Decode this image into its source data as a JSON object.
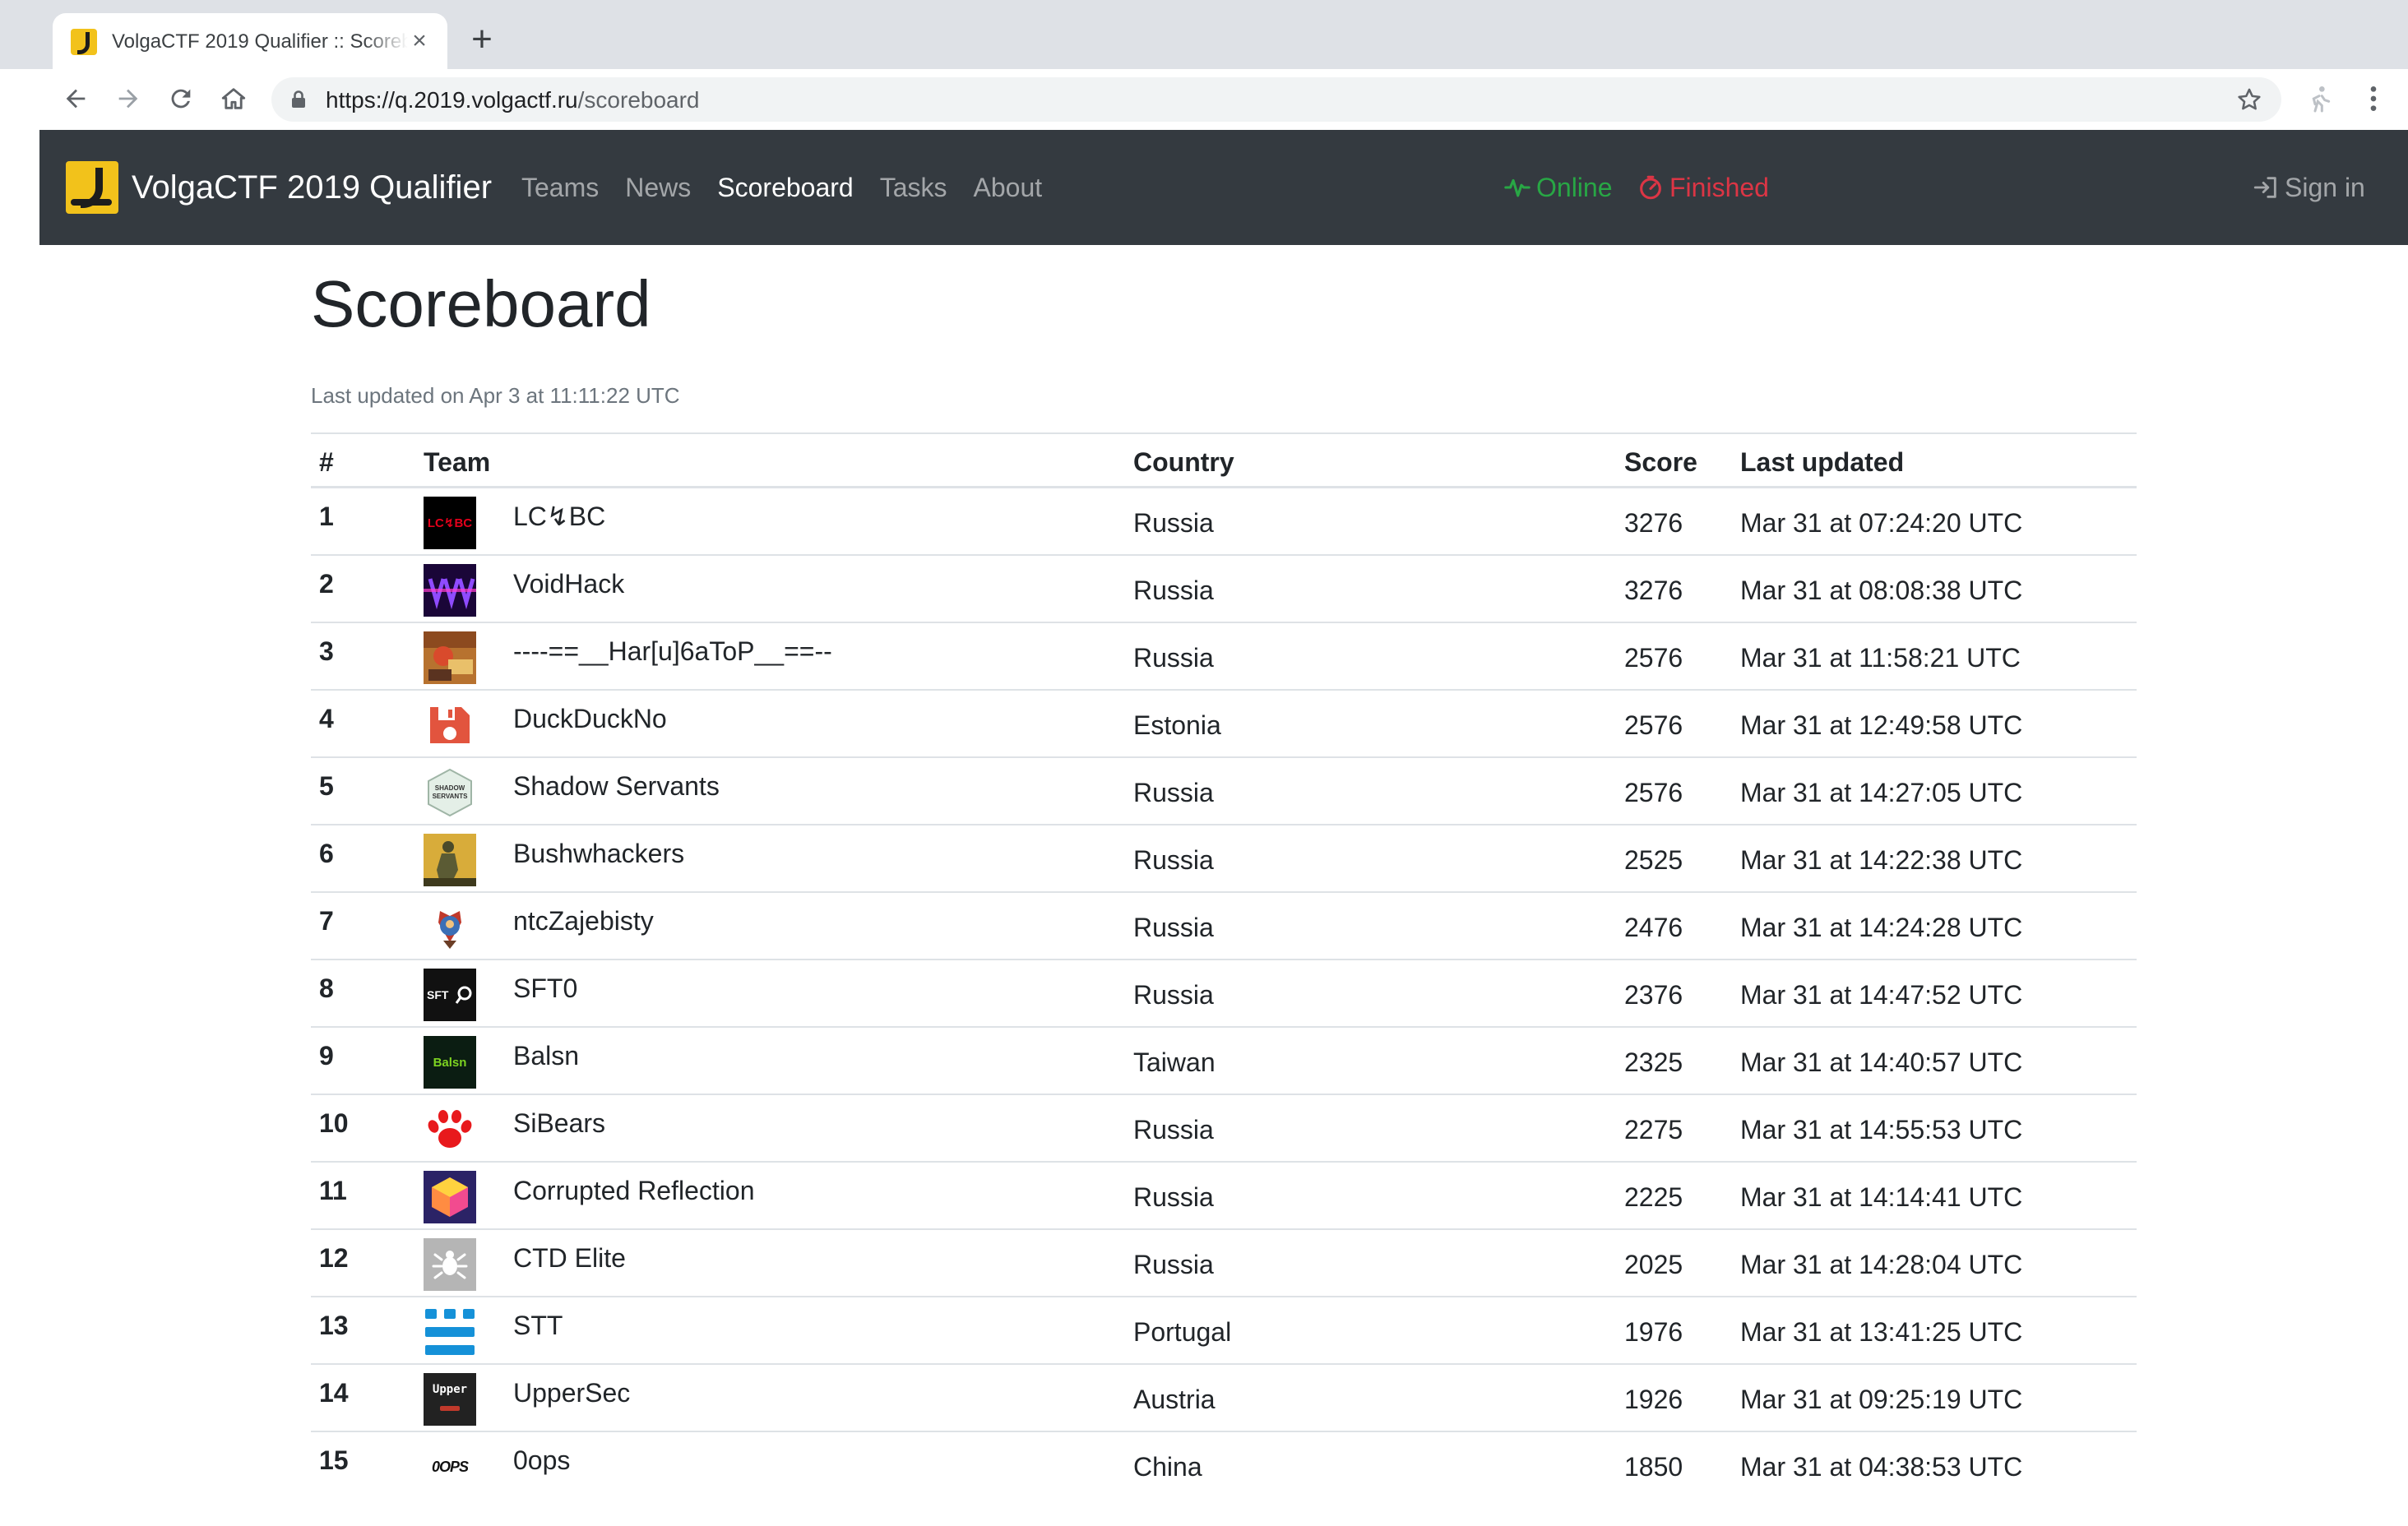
{
  "browser": {
    "tab_title": "VolgaCTF 2019 Qualifier :: Scoreboard",
    "url_host": "https://q.2019.volgactf.ru",
    "url_path": "/scoreboard"
  },
  "navbar": {
    "brand": "VolgaCTF 2019 Qualifier",
    "links": [
      {
        "label": "Teams"
      },
      {
        "label": "News"
      },
      {
        "label": "Scoreboard"
      },
      {
        "label": "Tasks"
      },
      {
        "label": "About"
      }
    ],
    "active_link": "Scoreboard",
    "status_online": "Online",
    "status_finished": "Finished",
    "sign_in": "Sign in",
    "colors": {
      "background": "#343a40",
      "online": "#28a745",
      "finished": "#dc3545"
    }
  },
  "page": {
    "title": "Scoreboard",
    "last_updated": "Last updated on Apr 3 at 11:11:22 UTC"
  },
  "table": {
    "headers": {
      "rank": "#",
      "team": "Team",
      "country": "Country",
      "score": "Score",
      "last_updated": "Last updated"
    },
    "rows": [
      {
        "rank": "1",
        "team": "LC↯BC",
        "country": "Russia",
        "score": "3276",
        "last_updated": "Mar 31 at 07:24:20 UTC",
        "logo": "lcbc",
        "logo_text": "LC↯BC"
      },
      {
        "rank": "2",
        "team": "VoidHack",
        "country": "Russia",
        "score": "3276",
        "last_updated": "Mar 31 at 08:08:38 UTC",
        "logo": "voidhack",
        "logo_text": ""
      },
      {
        "rank": "3",
        "team": "----==__Har[u]6aToP__==--",
        "country": "Russia",
        "score": "2576",
        "last_updated": "Mar 31 at 11:58:21 UTC",
        "logo": "harubator",
        "logo_text": ""
      },
      {
        "rank": "4",
        "team": "DuckDuckNo",
        "country": "Estonia",
        "score": "2576",
        "last_updated": "Mar 31 at 12:49:58 UTC",
        "logo": "duckducknno",
        "logo_text": ""
      },
      {
        "rank": "5",
        "team": "Shadow Servants",
        "country": "Russia",
        "score": "2576",
        "last_updated": "Mar 31 at 14:27:05 UTC",
        "logo": "shadowservants",
        "logo_text": "SHADOW SERVANTS"
      },
      {
        "rank": "6",
        "team": "Bushwhackers",
        "country": "Russia",
        "score": "2525",
        "last_updated": "Mar 31 at 14:22:38 UTC",
        "logo": "bushwhackers",
        "logo_text": ""
      },
      {
        "rank": "7",
        "team": "ntcZajebisty",
        "country": "Russia",
        "score": "2476",
        "last_updated": "Mar 31 at 14:24:28 UTC",
        "logo": "ntczajebisty",
        "logo_text": ""
      },
      {
        "rank": "8",
        "team": "SFT0",
        "country": "Russia",
        "score": "2376",
        "last_updated": "Mar 31 at 14:47:52 UTC",
        "logo": "sft0",
        "logo_text": "SFT"
      },
      {
        "rank": "9",
        "team": "Balsn",
        "country": "Taiwan",
        "score": "2325",
        "last_updated": "Mar 31 at 14:40:57 UTC",
        "logo": "balsn",
        "logo_text": "Balsn"
      },
      {
        "rank": "10",
        "team": "SiBears",
        "country": "Russia",
        "score": "2275",
        "last_updated": "Mar 31 at 14:55:53 UTC",
        "logo": "sibears",
        "logo_text": ""
      },
      {
        "rank": "11",
        "team": "Corrupted Reflection",
        "country": "Russia",
        "score": "2225",
        "last_updated": "Mar 31 at 14:14:41 UTC",
        "logo": "corrupted",
        "logo_text": ""
      },
      {
        "rank": "12",
        "team": "CTD Elite",
        "country": "Russia",
        "score": "2025",
        "last_updated": "Mar 31 at 14:28:04 UTC",
        "logo": "ctdelite",
        "logo_text": ""
      },
      {
        "rank": "13",
        "team": "STT",
        "country": "Portugal",
        "score": "1976",
        "last_updated": "Mar 31 at 13:41:25 UTC",
        "logo": "stt",
        "logo_text": ""
      },
      {
        "rank": "14",
        "team": "UpperSec",
        "country": "Austria",
        "score": "1926",
        "last_updated": "Mar 31 at 09:25:19 UTC",
        "logo": "uppersec",
        "logo_text": "Upper"
      },
      {
        "rank": "15",
        "team": "0ops",
        "country": "China",
        "score": "1850",
        "last_updated": "Mar 31 at 04:38:53 UTC",
        "logo": "0ops",
        "logo_text": "0OPS"
      }
    ]
  }
}
